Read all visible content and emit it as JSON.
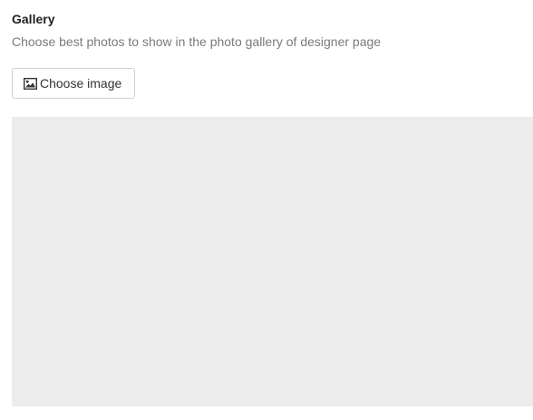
{
  "gallery": {
    "title": "Gallery",
    "description": "Choose best photos to show in the photo gallery of designer page",
    "choose_button": {
      "label": "Choose image",
      "icon": "image-icon"
    },
    "drop_area_color": "#ececec"
  }
}
